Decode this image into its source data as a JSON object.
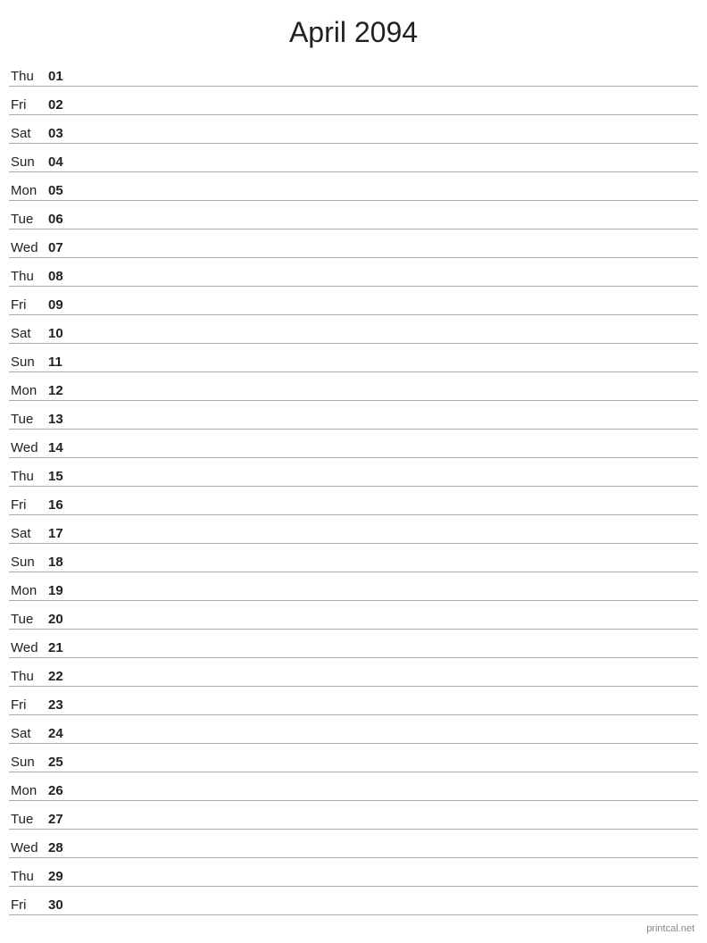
{
  "title": "April 2094",
  "watermark": "printcal.net",
  "days": [
    {
      "name": "Thu",
      "number": "01"
    },
    {
      "name": "Fri",
      "number": "02"
    },
    {
      "name": "Sat",
      "number": "03"
    },
    {
      "name": "Sun",
      "number": "04"
    },
    {
      "name": "Mon",
      "number": "05"
    },
    {
      "name": "Tue",
      "number": "06"
    },
    {
      "name": "Wed",
      "number": "07"
    },
    {
      "name": "Thu",
      "number": "08"
    },
    {
      "name": "Fri",
      "number": "09"
    },
    {
      "name": "Sat",
      "number": "10"
    },
    {
      "name": "Sun",
      "number": "11"
    },
    {
      "name": "Mon",
      "number": "12"
    },
    {
      "name": "Tue",
      "number": "13"
    },
    {
      "name": "Wed",
      "number": "14"
    },
    {
      "name": "Thu",
      "number": "15"
    },
    {
      "name": "Fri",
      "number": "16"
    },
    {
      "name": "Sat",
      "number": "17"
    },
    {
      "name": "Sun",
      "number": "18"
    },
    {
      "name": "Mon",
      "number": "19"
    },
    {
      "name": "Tue",
      "number": "20"
    },
    {
      "name": "Wed",
      "number": "21"
    },
    {
      "name": "Thu",
      "number": "22"
    },
    {
      "name": "Fri",
      "number": "23"
    },
    {
      "name": "Sat",
      "number": "24"
    },
    {
      "name": "Sun",
      "number": "25"
    },
    {
      "name": "Mon",
      "number": "26"
    },
    {
      "name": "Tue",
      "number": "27"
    },
    {
      "name": "Wed",
      "number": "28"
    },
    {
      "name": "Thu",
      "number": "29"
    },
    {
      "name": "Fri",
      "number": "30"
    }
  ]
}
